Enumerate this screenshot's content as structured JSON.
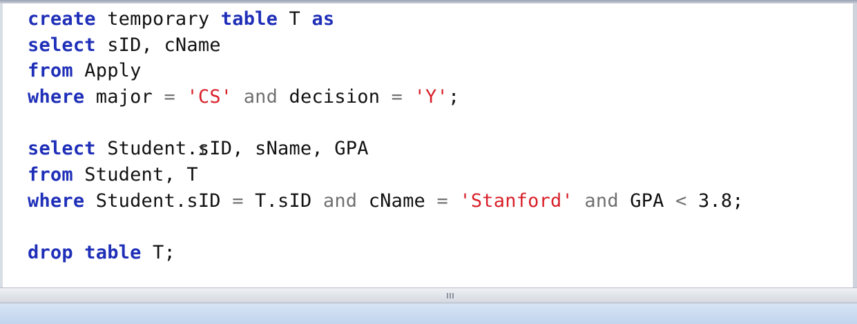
{
  "editor": {
    "lines": [
      [
        {
          "t": "create",
          "c": "kw"
        },
        {
          "t": " ",
          "c": "plain"
        },
        {
          "t": "temporary",
          "c": "plain"
        },
        {
          "t": " ",
          "c": "plain"
        },
        {
          "t": "table",
          "c": "kw"
        },
        {
          "t": " T ",
          "c": "plain"
        },
        {
          "t": "as",
          "c": "kw"
        }
      ],
      [
        {
          "t": "select",
          "c": "kw"
        },
        {
          "t": " sID, cName",
          "c": "plain"
        }
      ],
      [
        {
          "t": "from",
          "c": "kw"
        },
        {
          "t": " Apply",
          "c": "plain"
        }
      ],
      [
        {
          "t": "where",
          "c": "kw"
        },
        {
          "t": " major ",
          "c": "plain"
        },
        {
          "t": "=",
          "c": "op"
        },
        {
          "t": " ",
          "c": "plain"
        },
        {
          "t": "'CS'",
          "c": "str"
        },
        {
          "t": " ",
          "c": "plain"
        },
        {
          "t": "and",
          "c": "op"
        },
        {
          "t": " decision ",
          "c": "plain"
        },
        {
          "t": "=",
          "c": "op"
        },
        {
          "t": " ",
          "c": "plain"
        },
        {
          "t": "'Y'",
          "c": "str"
        },
        {
          "t": ";",
          "c": "plain"
        }
      ],
      [],
      [
        {
          "t": "select",
          "c": "kw"
        },
        {
          "t": " Student.sID, sName, GPA",
          "c": "plain"
        }
      ],
      [
        {
          "t": "from",
          "c": "kw"
        },
        {
          "t": " Student, T",
          "c": "plain"
        }
      ],
      [
        {
          "t": "where",
          "c": "kw"
        },
        {
          "t": " Student.sID ",
          "c": "plain"
        },
        {
          "t": "=",
          "c": "op"
        },
        {
          "t": " T.sID ",
          "c": "plain"
        },
        {
          "t": "and",
          "c": "op"
        },
        {
          "t": " cName ",
          "c": "plain"
        },
        {
          "t": "=",
          "c": "op"
        },
        {
          "t": " ",
          "c": "plain"
        },
        {
          "t": "'Stanford'",
          "c": "str"
        },
        {
          "t": " ",
          "c": "plain"
        },
        {
          "t": "and",
          "c": "op"
        },
        {
          "t": " GPA ",
          "c": "plain"
        },
        {
          "t": "<",
          "c": "op"
        },
        {
          "t": " 3.8;",
          "c": "plain"
        }
      ],
      [],
      [
        {
          "t": "drop",
          "c": "kw"
        },
        {
          "t": " ",
          "c": "plain"
        },
        {
          "t": "table",
          "c": "kw"
        },
        {
          "t": " T;",
          "c": "plain"
        }
      ]
    ]
  },
  "icons": {
    "splitter_grip": "splitter-grip-icon",
    "text_cursor": "ibeam-cursor-icon"
  },
  "colors": {
    "keyword": "#1f2fb8",
    "string": "#d8202a",
    "operator": "#707070",
    "text": "#111111"
  }
}
